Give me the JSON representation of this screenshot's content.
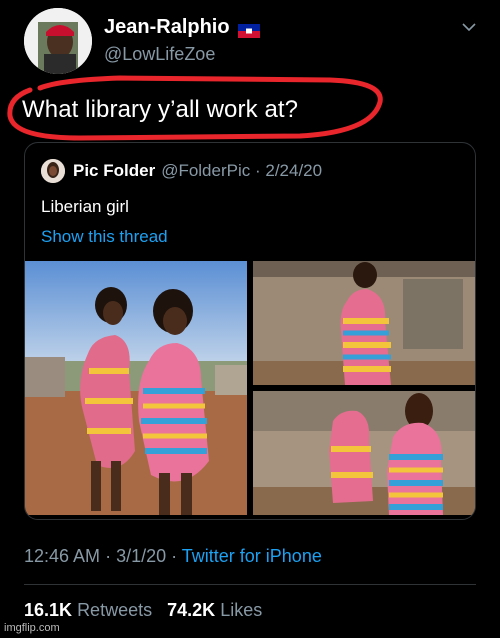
{
  "tweet": {
    "author_name": "Jean-Ralphio",
    "author_handle": "@LowLifeZoe",
    "text": "What library y’all work at?",
    "flag_icon": "haiti-flag-icon",
    "timestamp": "12:46 AM",
    "date": "3/1/20",
    "source": "Twitter for iPhone",
    "retweets_count": "16.1K",
    "retweets_label": "Retweets",
    "likes_count": "74.2K",
    "likes_label": "Likes"
  },
  "quote": {
    "author_name": "Pic Folder",
    "author_handle": "@FolderPic",
    "date": "2/24/20",
    "text": "Liberian girl",
    "link": "Show this thread"
  },
  "watermark": "imgflip.com",
  "colors": {
    "background": "#000000",
    "secondary_text": "#8899a6",
    "link": "#1da1f2",
    "annotation_red": "#e8262b"
  }
}
